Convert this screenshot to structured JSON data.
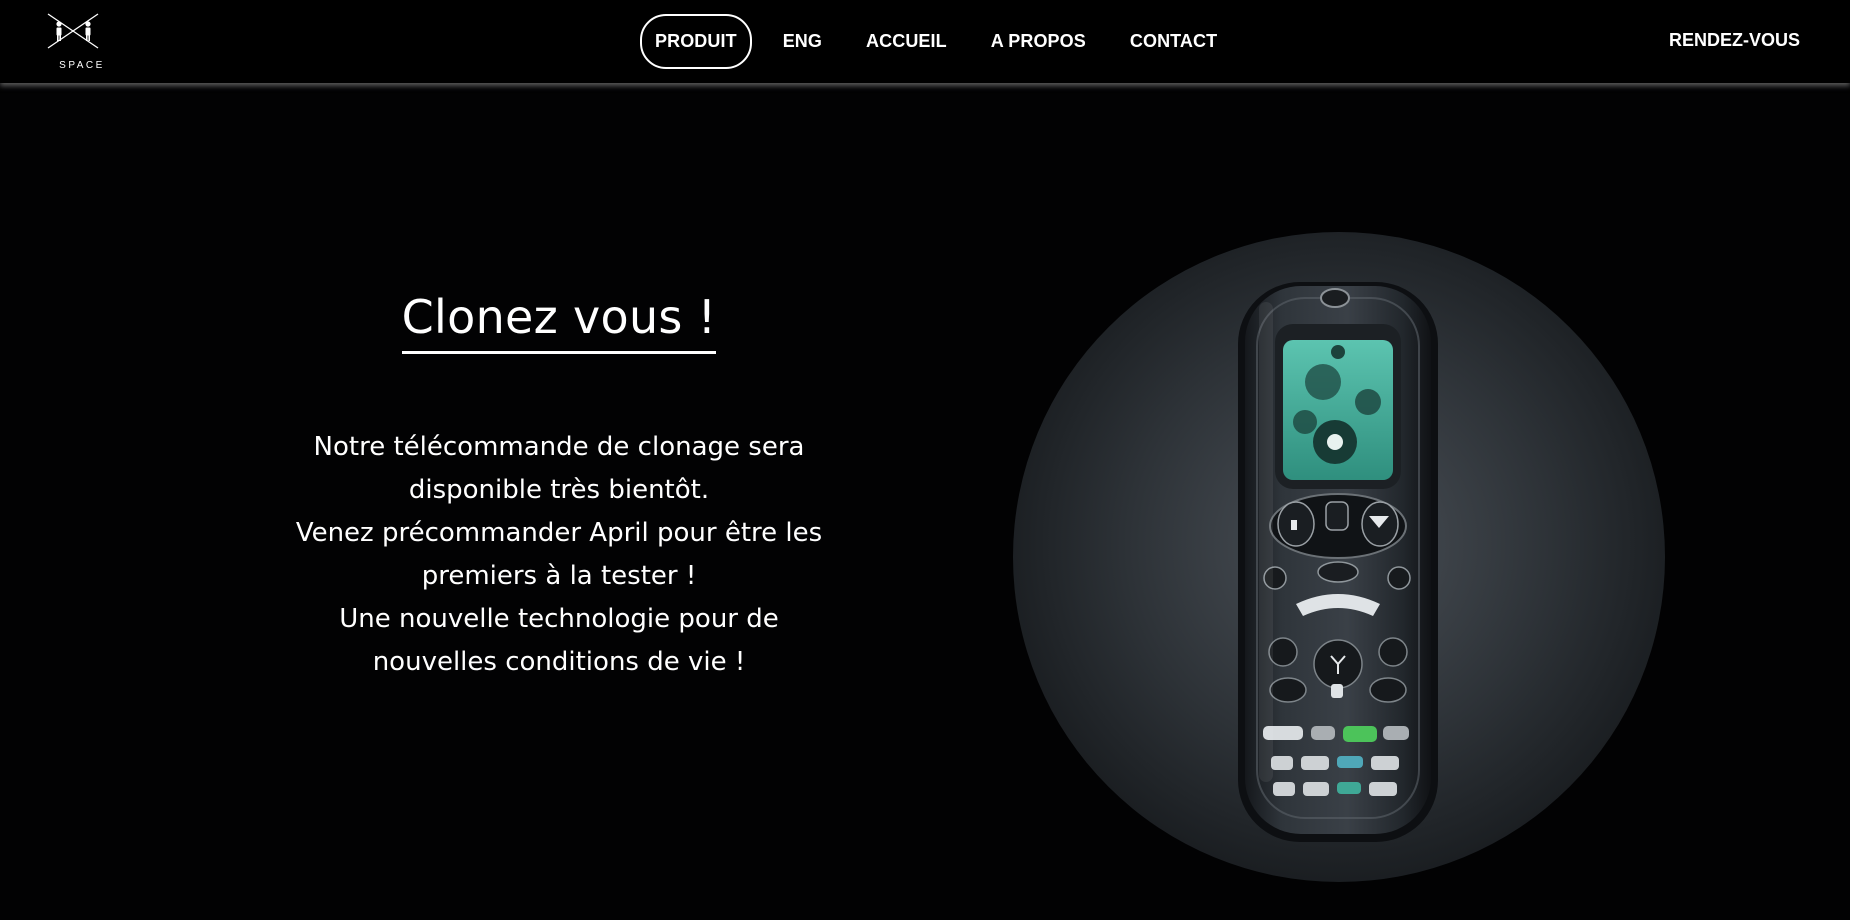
{
  "header": {
    "logo_text": "SPACE",
    "nav": [
      {
        "label": "PRODUIT",
        "active": true
      },
      {
        "label": "ENG",
        "active": false
      },
      {
        "label": "ACCUEIL",
        "active": false
      },
      {
        "label": "A PROPOS",
        "active": false
      },
      {
        "label": "CONTACT",
        "active": false
      }
    ],
    "cta_label": "RENDEZ-VOUS"
  },
  "hero": {
    "title": "Clonez vous !",
    "body_lines": [
      "Notre télécommande de clonage sera",
      "disponible très bientôt.",
      "Venez précommander April pour être les",
      "premiers à la tester !",
      "Une nouvelle technologie pour de",
      "nouvelles conditions de vie !"
    ]
  },
  "product": {
    "image_subject": "remote-control-image"
  },
  "colors": {
    "background": "#020203",
    "text": "#ffffff",
    "accent_teal": "#3fa896",
    "accent_green": "#4cc35a"
  }
}
